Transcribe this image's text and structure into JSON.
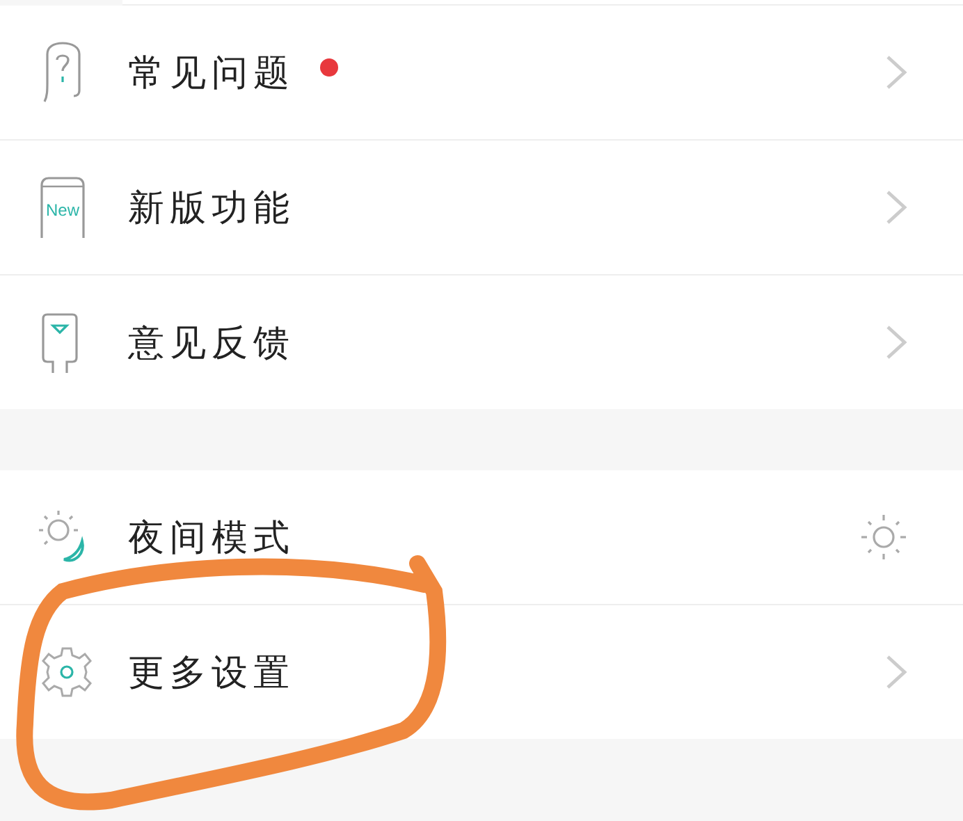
{
  "sections": [
    {
      "items": [
        {
          "label": "常见问题",
          "color": "#e8383d",
          "kind": "chevron"
        },
        {
          "label": "新版功能",
          "icon_label": "New",
          "kind": "chevron"
        },
        {
          "label": "意见反馈",
          "kind": "chevron"
        }
      ]
    },
    {
      "items": [
        {
          "label": "夜间模式",
          "kind": "sun"
        },
        {
          "label": "更多设置",
          "kind": "chevron"
        }
      ]
    }
  ]
}
